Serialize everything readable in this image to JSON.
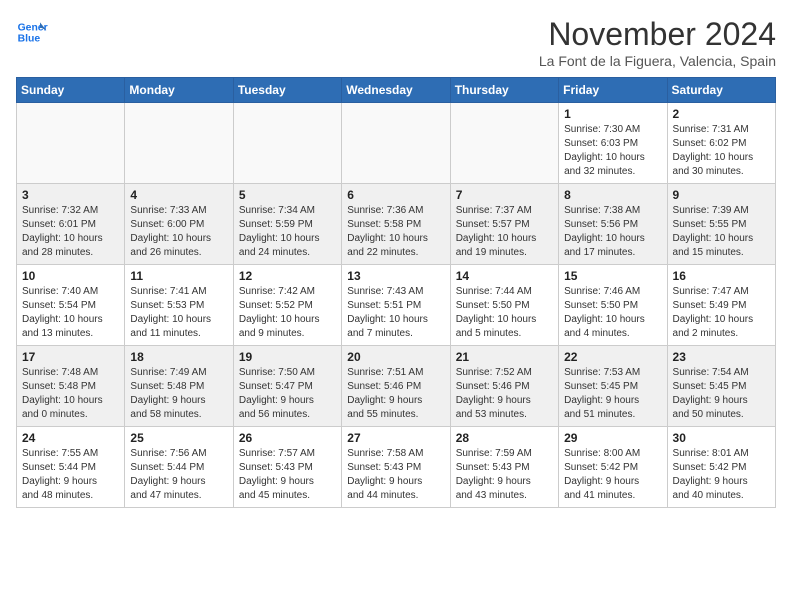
{
  "header": {
    "logo_line1": "General",
    "logo_line2": "Blue",
    "month": "November 2024",
    "location": "La Font de la Figuera, Valencia, Spain"
  },
  "weekdays": [
    "Sunday",
    "Monday",
    "Tuesday",
    "Wednesday",
    "Thursday",
    "Friday",
    "Saturday"
  ],
  "weeks": [
    [
      {
        "day": "",
        "info": ""
      },
      {
        "day": "",
        "info": ""
      },
      {
        "day": "",
        "info": ""
      },
      {
        "day": "",
        "info": ""
      },
      {
        "day": "",
        "info": ""
      },
      {
        "day": "1",
        "info": "Sunrise: 7:30 AM\nSunset: 6:03 PM\nDaylight: 10 hours\nand 32 minutes."
      },
      {
        "day": "2",
        "info": "Sunrise: 7:31 AM\nSunset: 6:02 PM\nDaylight: 10 hours\nand 30 minutes."
      }
    ],
    [
      {
        "day": "3",
        "info": "Sunrise: 7:32 AM\nSunset: 6:01 PM\nDaylight: 10 hours\nand 28 minutes."
      },
      {
        "day": "4",
        "info": "Sunrise: 7:33 AM\nSunset: 6:00 PM\nDaylight: 10 hours\nand 26 minutes."
      },
      {
        "day": "5",
        "info": "Sunrise: 7:34 AM\nSunset: 5:59 PM\nDaylight: 10 hours\nand 24 minutes."
      },
      {
        "day": "6",
        "info": "Sunrise: 7:36 AM\nSunset: 5:58 PM\nDaylight: 10 hours\nand 22 minutes."
      },
      {
        "day": "7",
        "info": "Sunrise: 7:37 AM\nSunset: 5:57 PM\nDaylight: 10 hours\nand 19 minutes."
      },
      {
        "day": "8",
        "info": "Sunrise: 7:38 AM\nSunset: 5:56 PM\nDaylight: 10 hours\nand 17 minutes."
      },
      {
        "day": "9",
        "info": "Sunrise: 7:39 AM\nSunset: 5:55 PM\nDaylight: 10 hours\nand 15 minutes."
      }
    ],
    [
      {
        "day": "10",
        "info": "Sunrise: 7:40 AM\nSunset: 5:54 PM\nDaylight: 10 hours\nand 13 minutes."
      },
      {
        "day": "11",
        "info": "Sunrise: 7:41 AM\nSunset: 5:53 PM\nDaylight: 10 hours\nand 11 minutes."
      },
      {
        "day": "12",
        "info": "Sunrise: 7:42 AM\nSunset: 5:52 PM\nDaylight: 10 hours\nand 9 minutes."
      },
      {
        "day": "13",
        "info": "Sunrise: 7:43 AM\nSunset: 5:51 PM\nDaylight: 10 hours\nand 7 minutes."
      },
      {
        "day": "14",
        "info": "Sunrise: 7:44 AM\nSunset: 5:50 PM\nDaylight: 10 hours\nand 5 minutes."
      },
      {
        "day": "15",
        "info": "Sunrise: 7:46 AM\nSunset: 5:50 PM\nDaylight: 10 hours\nand 4 minutes."
      },
      {
        "day": "16",
        "info": "Sunrise: 7:47 AM\nSunset: 5:49 PM\nDaylight: 10 hours\nand 2 minutes."
      }
    ],
    [
      {
        "day": "17",
        "info": "Sunrise: 7:48 AM\nSunset: 5:48 PM\nDaylight: 10 hours\nand 0 minutes."
      },
      {
        "day": "18",
        "info": "Sunrise: 7:49 AM\nSunset: 5:48 PM\nDaylight: 9 hours\nand 58 minutes."
      },
      {
        "day": "19",
        "info": "Sunrise: 7:50 AM\nSunset: 5:47 PM\nDaylight: 9 hours\nand 56 minutes."
      },
      {
        "day": "20",
        "info": "Sunrise: 7:51 AM\nSunset: 5:46 PM\nDaylight: 9 hours\nand 55 minutes."
      },
      {
        "day": "21",
        "info": "Sunrise: 7:52 AM\nSunset: 5:46 PM\nDaylight: 9 hours\nand 53 minutes."
      },
      {
        "day": "22",
        "info": "Sunrise: 7:53 AM\nSunset: 5:45 PM\nDaylight: 9 hours\nand 51 minutes."
      },
      {
        "day": "23",
        "info": "Sunrise: 7:54 AM\nSunset: 5:45 PM\nDaylight: 9 hours\nand 50 minutes."
      }
    ],
    [
      {
        "day": "24",
        "info": "Sunrise: 7:55 AM\nSunset: 5:44 PM\nDaylight: 9 hours\nand 48 minutes."
      },
      {
        "day": "25",
        "info": "Sunrise: 7:56 AM\nSunset: 5:44 PM\nDaylight: 9 hours\nand 47 minutes."
      },
      {
        "day": "26",
        "info": "Sunrise: 7:57 AM\nSunset: 5:43 PM\nDaylight: 9 hours\nand 45 minutes."
      },
      {
        "day": "27",
        "info": "Sunrise: 7:58 AM\nSunset: 5:43 PM\nDaylight: 9 hours\nand 44 minutes."
      },
      {
        "day": "28",
        "info": "Sunrise: 7:59 AM\nSunset: 5:43 PM\nDaylight: 9 hours\nand 43 minutes."
      },
      {
        "day": "29",
        "info": "Sunrise: 8:00 AM\nSunset: 5:42 PM\nDaylight: 9 hours\nand 41 minutes."
      },
      {
        "day": "30",
        "info": "Sunrise: 8:01 AM\nSunset: 5:42 PM\nDaylight: 9 hours\nand 40 minutes."
      }
    ]
  ]
}
